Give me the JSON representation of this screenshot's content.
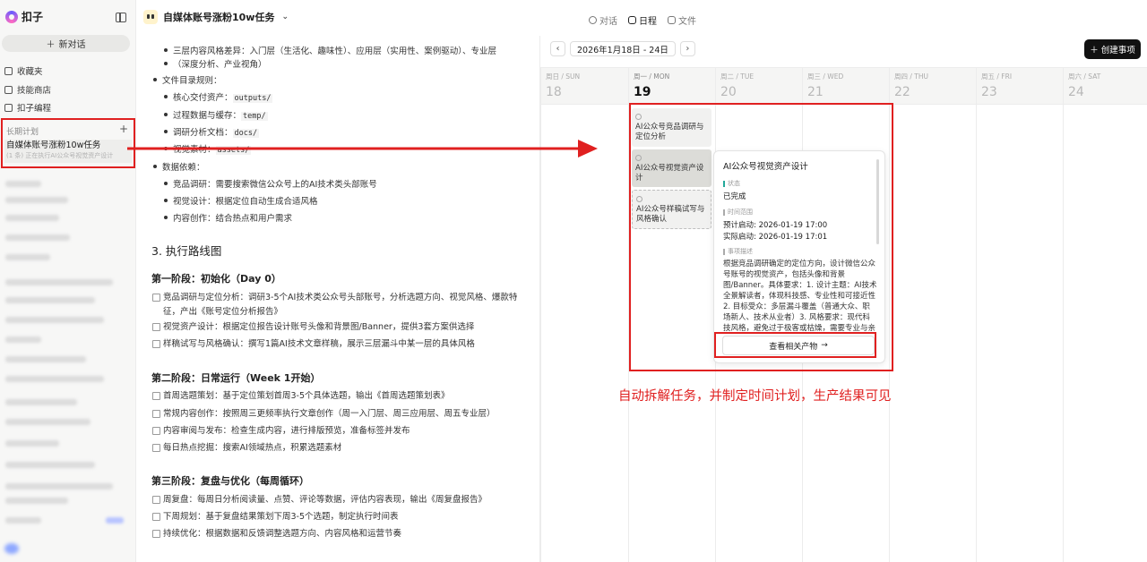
{
  "sidebar": {
    "brand": "扣子",
    "new_chat": "新对话",
    "nav": [
      "收藏夹",
      "技能商店",
      "扣子编程"
    ],
    "plan_section": "长期计划",
    "plan_item_title": "自媒体账号涨粉10w任务",
    "plan_item_status": "(1 条) 正在执行AI公众号视觉资产设计"
  },
  "topbar": {
    "task_title": "自媒体账号涨粉10w任务",
    "tabs": [
      "对话",
      "日程",
      "文件"
    ],
    "active_tab": "日程"
  },
  "doc": {
    "lines": [
      "三层内容风格差异：入门层（生活化、趣味性）、应用层（实用性、案例驱动）、专业层",
      "（深度分析、产业视角）",
      "文件目录规则：",
      "核心交付资产：",
      "过程数据与缓存：",
      "调研分析文档：",
      "视觉素材：",
      "数据依赖：",
      "竞品调研：需要搜索微信公众号上的AI技术类头部账号",
      "视觉设计：根据定位自动生成合适风格",
      "内容创作：结合热点和用户需求"
    ],
    "codes": [
      "outputs/",
      "temp/",
      "docs/",
      "assets/"
    ],
    "section_title": "3. 执行路线图",
    "phase1": "第一阶段：初始化（Day 0）",
    "phase1_tasks": [
      "竞品调研与定位分析：调研3-5个AI技术类公众号头部账号，分析选题方向、视觉风格、爆款特征，产出《账号定位分析报告》",
      "视觉资产设计：根据定位报告设计账号头像和背景图/Banner，提供3套方案供选择",
      "样稿试写与风格确认：撰写1篇AI技术文章样稿，展示三层漏斗中某一层的具体风格"
    ],
    "phase2": "第二阶段：日常运行（Week 1开始）",
    "phase2_tasks": [
      "首周选题策划：基于定位策划首周3-5个具体选题，输出《首周选题策划表》",
      "常规内容创作：按照周三更频率执行文章创作（周一入门层、周三应用层、周五专业层）",
      "内容审阅与发布：检查生成内容，进行排版预览，准备标签并发布",
      "每日热点挖掘：搜索AI领域热点，积累选题素材"
    ],
    "phase3": "第三阶段：复盘与优化（每周循环）",
    "phase3_tasks": [
      "周复盘：每周日分析阅读量、点赞、评论等数据，评估内容表现，输出《周复盘报告》",
      "下周规划：基于复盘结果策划下周3-5个选题，制定执行时间表",
      "持续优化：根据数据和反馈调整选题方向、内容风格和运营节奏"
    ]
  },
  "calendar": {
    "range": "2026年1月18日 - 24日",
    "create_label": "创建事项",
    "days": [
      {
        "name": "周日 / SUN",
        "num": "18"
      },
      {
        "name": "周一 / MON",
        "num": "19"
      },
      {
        "name": "周二 / TUE",
        "num": "20"
      },
      {
        "name": "周三 / WED",
        "num": "21"
      },
      {
        "name": "周四 / THU",
        "num": "22"
      },
      {
        "name": "周五 / FRI",
        "num": "23"
      },
      {
        "name": "周六 / SAT",
        "num": "24"
      }
    ],
    "today": "19",
    "events": [
      "AI公众号竞品调研与定位分析",
      "AI公众号视觉资产设计",
      "AI公众号样稿试写与风格确认"
    ],
    "popup": {
      "title": "AI公众号视觉资产设计",
      "status_label": "状态",
      "status": "已完成",
      "time_label": "时间范围",
      "planned": "预计启动: 2026-01-19 17:00",
      "actual": "实际启动: 2026-01-19 17:01",
      "desc_label": "事项描述",
      "desc": "根据竞品调研确定的定位方向，设计微信公众号账号的视觉资产，包括头像和背景图/Banner。具体要求：1. 设计主题：AI技术全景解读者，体现科技感、专业性和可接近性 2. 目标受众：多层漏斗覆盖（普通大众、职场新人、技术从业者）3. 风格要求：现代科技风格，避免过于极客或枯燥，需要专业与亲和的平衡",
      "button": "查看相关产物"
    }
  },
  "annotation": "自动拆解任务，并制定时间计划，生产结果可见",
  "colors": {
    "annotation_red": "#e02020",
    "accent_teal": "#22a89a"
  }
}
